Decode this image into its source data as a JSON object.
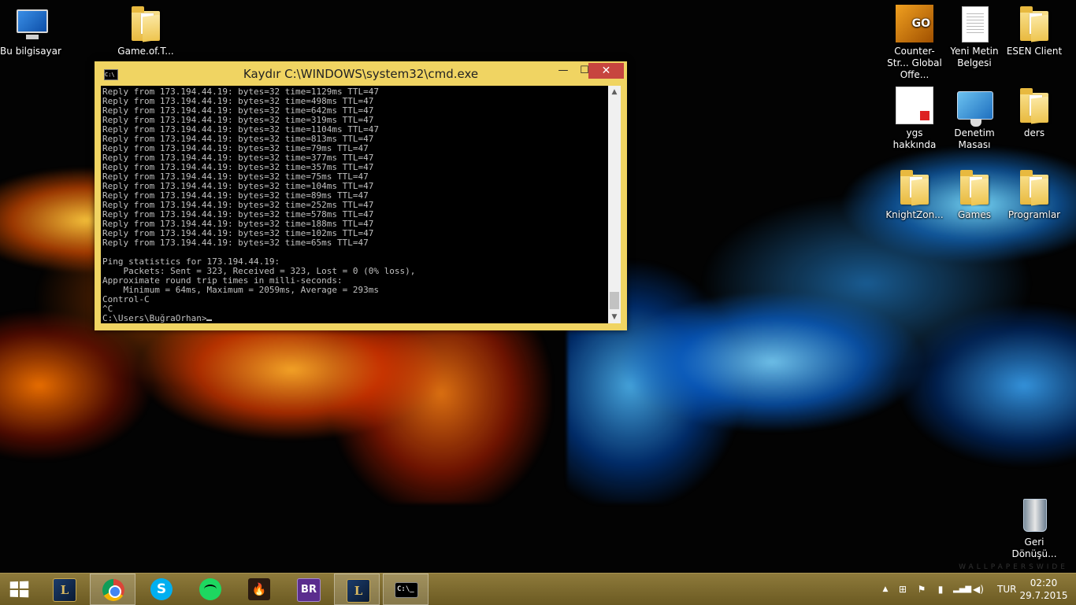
{
  "desktop": {
    "icons": [
      {
        "label": "Bu bilgisayar"
      },
      {
        "label": "Game.of.T..."
      },
      {
        "label": "Counter-Str... Global Offe..."
      },
      {
        "label": "Yeni Metin Belgesi"
      },
      {
        "label": "ESEN Client"
      },
      {
        "label": "ygs hakkında"
      },
      {
        "label": "Denetim Masası"
      },
      {
        "label": "ders"
      },
      {
        "label": "KnightZon..."
      },
      {
        "label": "Games"
      },
      {
        "label": "Programlar"
      },
      {
        "label": "Geri Dönüşü..."
      }
    ],
    "watermark": "WALLPAPERSWIDE"
  },
  "window": {
    "title": "Kaydır C:\\WINDOWS\\system32\\cmd.exe",
    "min_label": "—",
    "max_label": "☐",
    "close_label": "✕",
    "title_icon": "C:\\",
    "accent_color": "#f0d462"
  },
  "console": {
    "lines": [
      "Reply from 173.194.44.19: bytes=32 time=1129ms TTL=47",
      "Reply from 173.194.44.19: bytes=32 time=498ms TTL=47",
      "Reply from 173.194.44.19: bytes=32 time=642ms TTL=47",
      "Reply from 173.194.44.19: bytes=32 time=319ms TTL=47",
      "Reply from 173.194.44.19: bytes=32 time=1104ms TTL=47",
      "Reply from 173.194.44.19: bytes=32 time=813ms TTL=47",
      "Reply from 173.194.44.19: bytes=32 time=79ms TTL=47",
      "Reply from 173.194.44.19: bytes=32 time=377ms TTL=47",
      "Reply from 173.194.44.19: bytes=32 time=357ms TTL=47",
      "Reply from 173.194.44.19: bytes=32 time=75ms TTL=47",
      "Reply from 173.194.44.19: bytes=32 time=104ms TTL=47",
      "Reply from 173.194.44.19: bytes=32 time=89ms TTL=47",
      "Reply from 173.194.44.19: bytes=32 time=252ms TTL=47",
      "Reply from 173.194.44.19: bytes=32 time=578ms TTL=47",
      "Reply from 173.194.44.19: bytes=32 time=188ms TTL=47",
      "Reply from 173.194.44.19: bytes=32 time=102ms TTL=47",
      "Reply from 173.194.44.19: bytes=32 time=65ms TTL=47",
      "",
      "Ping statistics for 173.194.44.19:",
      "    Packets: Sent = 323, Received = 323, Lost = 0 (0% loss),",
      "Approximate round trip times in milli-seconds:",
      "    Minimum = 64ms, Maximum = 2059ms, Average = 293ms",
      "Control-C",
      "^C"
    ],
    "prompt": "C:\\Users\\BuğraOrhan>"
  },
  "taskbar": {
    "apps": [
      {
        "name": "League of Legends",
        "glyph": "L"
      },
      {
        "name": "Google Chrome",
        "glyph": ""
      },
      {
        "name": "Skype",
        "glyph": "S"
      },
      {
        "name": "Spotify",
        "glyph": ""
      },
      {
        "name": "Flame app",
        "glyph": "🔥"
      },
      {
        "name": "BR app",
        "glyph": "BR"
      },
      {
        "name": "League of Legends 2",
        "glyph": "L"
      },
      {
        "name": "Command Prompt",
        "glyph": "C:\\_"
      }
    ],
    "tray": {
      "icons": [
        "chevron-up-icon",
        "windows-flag-icon",
        "action-center-flag-icon",
        "power-icon",
        "network-signal-icon",
        "volume-icon"
      ],
      "language": "TUR",
      "time": "02:20",
      "date": "29.7.2015"
    }
  }
}
